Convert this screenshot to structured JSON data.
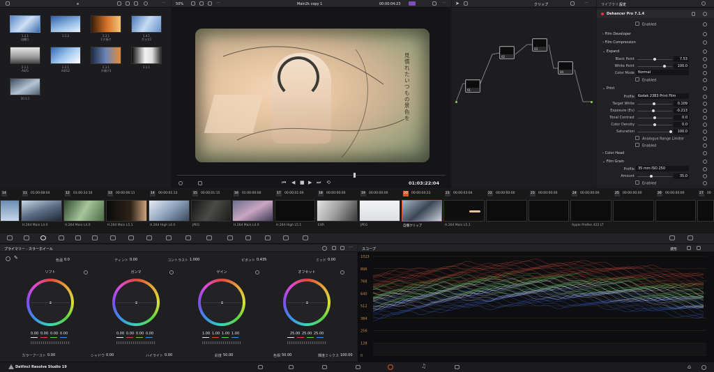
{
  "viewer": {
    "zoom": "50%",
    "clip_name": "Main2k copy 1",
    "timecode_top": "00:00:04:23",
    "timecode_bottom": "01:03:22:04",
    "subtitle_text": "見慣れたいつもの景色を"
  },
  "media_pool": {
    "clips": [
      {
        "id": "1.2.1",
        "name": "自撮り"
      },
      {
        "id": "1.2.2",
        "name": ""
      },
      {
        "id": "1.3.1",
        "name": "C夕焼け"
      },
      {
        "id": "1.4.1",
        "name": "ガラス1"
      },
      {
        "id": "2.1.1",
        "name": "A4/G"
      },
      {
        "id": "2.2.1",
        "name": "A4/G2"
      },
      {
        "id": "2.3.1",
        "name": "夕焼け3"
      },
      {
        "id": "3.1.1",
        "name": ""
      },
      {
        "id": "10.1.1",
        "name": ""
      }
    ]
  },
  "nodes": {
    "clip_mode": "クリップ",
    "items": [
      {
        "num": "01",
        "label": "01"
      },
      {
        "num": "02",
        "label": "02"
      },
      {
        "num": "03",
        "label": "03"
      },
      {
        "num": "04",
        "label": "04"
      }
    ]
  },
  "inspector": {
    "tabs": [
      "ライブラリ",
      "設定"
    ],
    "plugin": "Dehancer Pro 7.1.4",
    "enabled_label": "Enabled",
    "sections": {
      "film_developer": "Film Developer",
      "film_compression": "Film Compression",
      "expand": "Expand",
      "print": "Print",
      "color_head": "Color Head",
      "film_grain": "Film Grain"
    },
    "expand": {
      "black_point_label": "Black Point",
      "black_point": "7.53",
      "white_point_label": "White Point",
      "white_point": "100.0",
      "color_mode_label": "Color Mode",
      "color_mode": "Normal"
    },
    "print": {
      "profile_label": "Profile",
      "profile": "Kodak 2383 Print Film",
      "target_white_label": "Target White",
      "target_white": "0.109",
      "exposure_label": "Exposure (Ev)",
      "exposure": "-0.213",
      "tonal_contrast_label": "Tonal Contrast",
      "tonal_contrast": "0.0",
      "color_density_label": "Color Density",
      "color_density": "0.0",
      "saturation_label": "Saturation",
      "saturation": "100.0",
      "analogue_label": "Analogue Range Limiter"
    },
    "grain": {
      "profile_label": "Profile",
      "profile": "35 mm ISO 250",
      "amount_label": "Amount",
      "amount": "35.0"
    }
  },
  "timeline": {
    "cells": [
      {
        "v": "14",
        "tc": ""
      },
      {
        "v": "11",
        "tc": "01:00:08:04"
      },
      {
        "v": "12",
        "tc": "01:00:33:10"
      },
      {
        "v": "13",
        "tc": "00:00:06:11"
      },
      {
        "v": "14",
        "tc": "00:00:01:13"
      },
      {
        "v": "15",
        "tc": "00:00:01:15"
      },
      {
        "v": "16",
        "tc": "01:00:00:00"
      },
      {
        "v": "17",
        "tc": "00:00:01:00"
      },
      {
        "v": "18",
        "tc": "00:00:00:00"
      },
      {
        "v": "19",
        "tc": "00:00:00:00"
      },
      {
        "v": "20",
        "tc": "00:00:04:23"
      },
      {
        "v": "21",
        "tc": "00:00:03:04"
      },
      {
        "v": "22",
        "tc": "00:00:00:00"
      },
      {
        "v": "23",
        "tc": "00:00:00:00"
      },
      {
        "v": "24",
        "tc": "00:00:00:00"
      },
      {
        "v": "25",
        "tc": "00:00:00:00"
      },
      {
        "v": "26",
        "tc": "00:00:00:00"
      },
      {
        "v": "27",
        "tc": "00"
      }
    ],
    "clip_labels": [
      "H.264 Main L4.0",
      "H.264 Main L4.0",
      "H.264 Main L5.1",
      "H.264 High L4.0",
      "JPEG",
      "H.264 Main L4.0",
      "H.264 High L5.1",
      "EXR",
      "JPEG",
      "自撮クリップ",
      "H.264 Main L5.1",
      "Apple ProRes 422 LT"
    ]
  },
  "color_panel": {
    "title": "プライマリー - カラーホイール",
    "top_params": [
      {
        "label": "色温",
        "value": "0.0"
      },
      {
        "label": "ティント",
        "value": "0.00"
      },
      {
        "label": "コントラスト",
        "value": "1.000"
      },
      {
        "label": "ピボット",
        "value": "0.435"
      },
      {
        "label": "ミッド",
        "value": "0.00"
      }
    ],
    "wheels": [
      {
        "name": "リフト",
        "values": [
          "0.00",
          "0.00",
          "0.00",
          "0.00"
        ]
      },
      {
        "name": "ガンマ",
        "values": [
          "0.00",
          "0.00",
          "0.00",
          "0.00"
        ]
      },
      {
        "name": "ゲイン",
        "values": [
          "1.00",
          "1.00",
          "1.00",
          "1.00"
        ]
      },
      {
        "name": "オフセット",
        "values": [
          "25.00",
          "25.00",
          "25.00"
        ]
      }
    ],
    "bottom_params": [
      {
        "label": "カラーブースト",
        "value": "0.00"
      },
      {
        "label": "シャドウ",
        "value": "0.00"
      },
      {
        "label": "ハイライト",
        "value": "0.00"
      },
      {
        "label": "彩度",
        "value": "50.00"
      },
      {
        "label": "色相",
        "value": "50.00"
      },
      {
        "label": "輝度ミックス",
        "value": "100.00"
      }
    ]
  },
  "scope": {
    "title": "スコープ",
    "mode": "波形",
    "scale": [
      "1023",
      "896",
      "768",
      "640",
      "512",
      "384",
      "256",
      "128",
      "0"
    ]
  },
  "footer": {
    "app_name": "DaVinci Resolve Studio 19"
  }
}
